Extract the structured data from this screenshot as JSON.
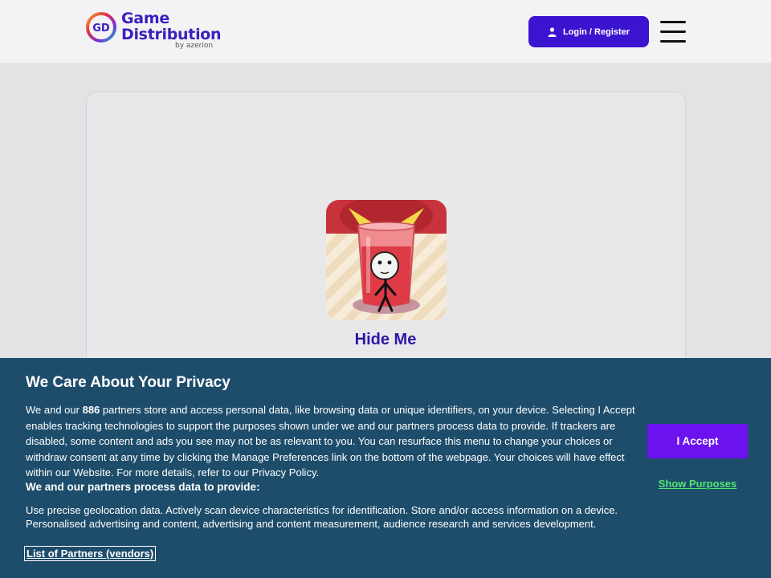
{
  "header": {
    "logo": {
      "mark_text": "GD",
      "line1": "Game",
      "line2": "Distribution",
      "sub": "by azerion"
    },
    "login_label": "Login / Register",
    "icons": {
      "login": "user-icon",
      "menu": "hamburger-menu-icon"
    }
  },
  "game": {
    "title": "Hide Me"
  },
  "consent": {
    "title": "We Care About Your Privacy",
    "body_intro": "We and our ",
    "partner_count": "886",
    "body_rest": " partners store and access personal data, like browsing data or unique identifiers, on your device. Selecting I Accept enables tracking technologies to support the purposes shown under we and our partners process data to provide. If trackers are disabled, some content and ads you see may not be as relevant to you. You can resurface this menu to change your choices or withdraw consent at any time by clicking the Manage Preferences link on the bottom of the webpage. Your choices will have effect within our Website. For more details, refer to our Privacy Policy.",
    "subhead": "We and our partners process data to provide:",
    "purposes": "Use precise geolocation data. Actively scan device characteristics for identification. Store and/or access information on a device. Personalised advertising and content, advertising and content measurement, audience research and services development.",
    "partners_link": "List of Partners (vendors)",
    "accept_label": "I Accept",
    "show_purposes_label": "Show Purposes"
  },
  "colors": {
    "brand": "#3b14d0",
    "consent_bg": "#1e4d6b",
    "accept": "#6b12ef",
    "link_green": "#4ee76d",
    "title_purple": "#2b16a8"
  }
}
